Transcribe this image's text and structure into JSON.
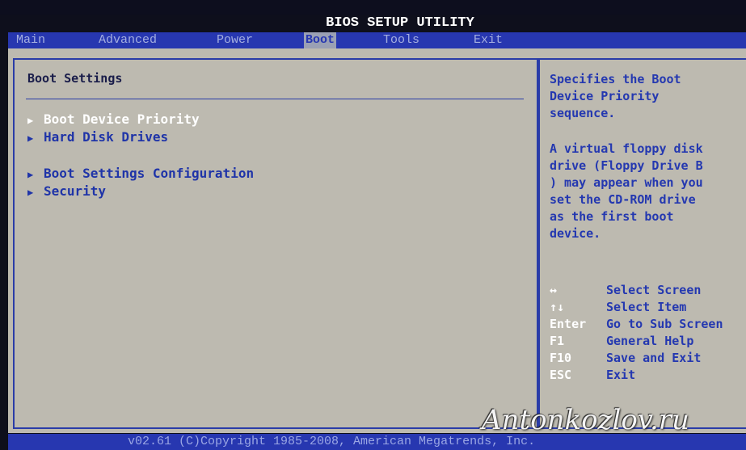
{
  "app": {
    "title": "BIOS SETUP UTILITY"
  },
  "menu": {
    "items": [
      {
        "label": "Main"
      },
      {
        "label": "Advanced"
      },
      {
        "label": "Power"
      },
      {
        "label": "Boot"
      },
      {
        "label": "Tools"
      },
      {
        "label": "Exit"
      }
    ],
    "active": "Boot"
  },
  "main": {
    "section_title": "Boot Settings",
    "entries": [
      {
        "label": "Boot Device Priority",
        "selected": true
      },
      {
        "label": "Hard Disk Drives",
        "selected": false
      },
      {
        "label": "Boot Settings Configuration",
        "selected": false
      },
      {
        "label": "Security",
        "selected": false
      }
    ]
  },
  "help": {
    "description": "Specifies the Boot\nDevice Priority\nsequence.",
    "note": "A virtual floppy disk\ndrive (Floppy Drive B\n) may appear when you\nset the CD-ROM drive\nas the first boot\ndevice.",
    "keys": [
      {
        "key": "↔",
        "desc": "Select Screen"
      },
      {
        "key": "↑↓",
        "desc": "Select Item"
      },
      {
        "key": "Enter",
        "desc": "Go to Sub Screen"
      },
      {
        "key": "F1",
        "desc": "General Help"
      },
      {
        "key": "F10",
        "desc": "Save and Exit"
      },
      {
        "key": "ESC",
        "desc": "Exit"
      }
    ]
  },
  "footer": {
    "copyright": "v02.61 (C)Copyright 1985-2008, American Megatrends, Inc."
  },
  "watermark": {
    "text": "Antonkozlov.ru"
  },
  "colors": {
    "background": "#bdbab0",
    "bar": "#2737b0",
    "accent_text": "#2438b0",
    "highlight_text": "#ffffff"
  }
}
